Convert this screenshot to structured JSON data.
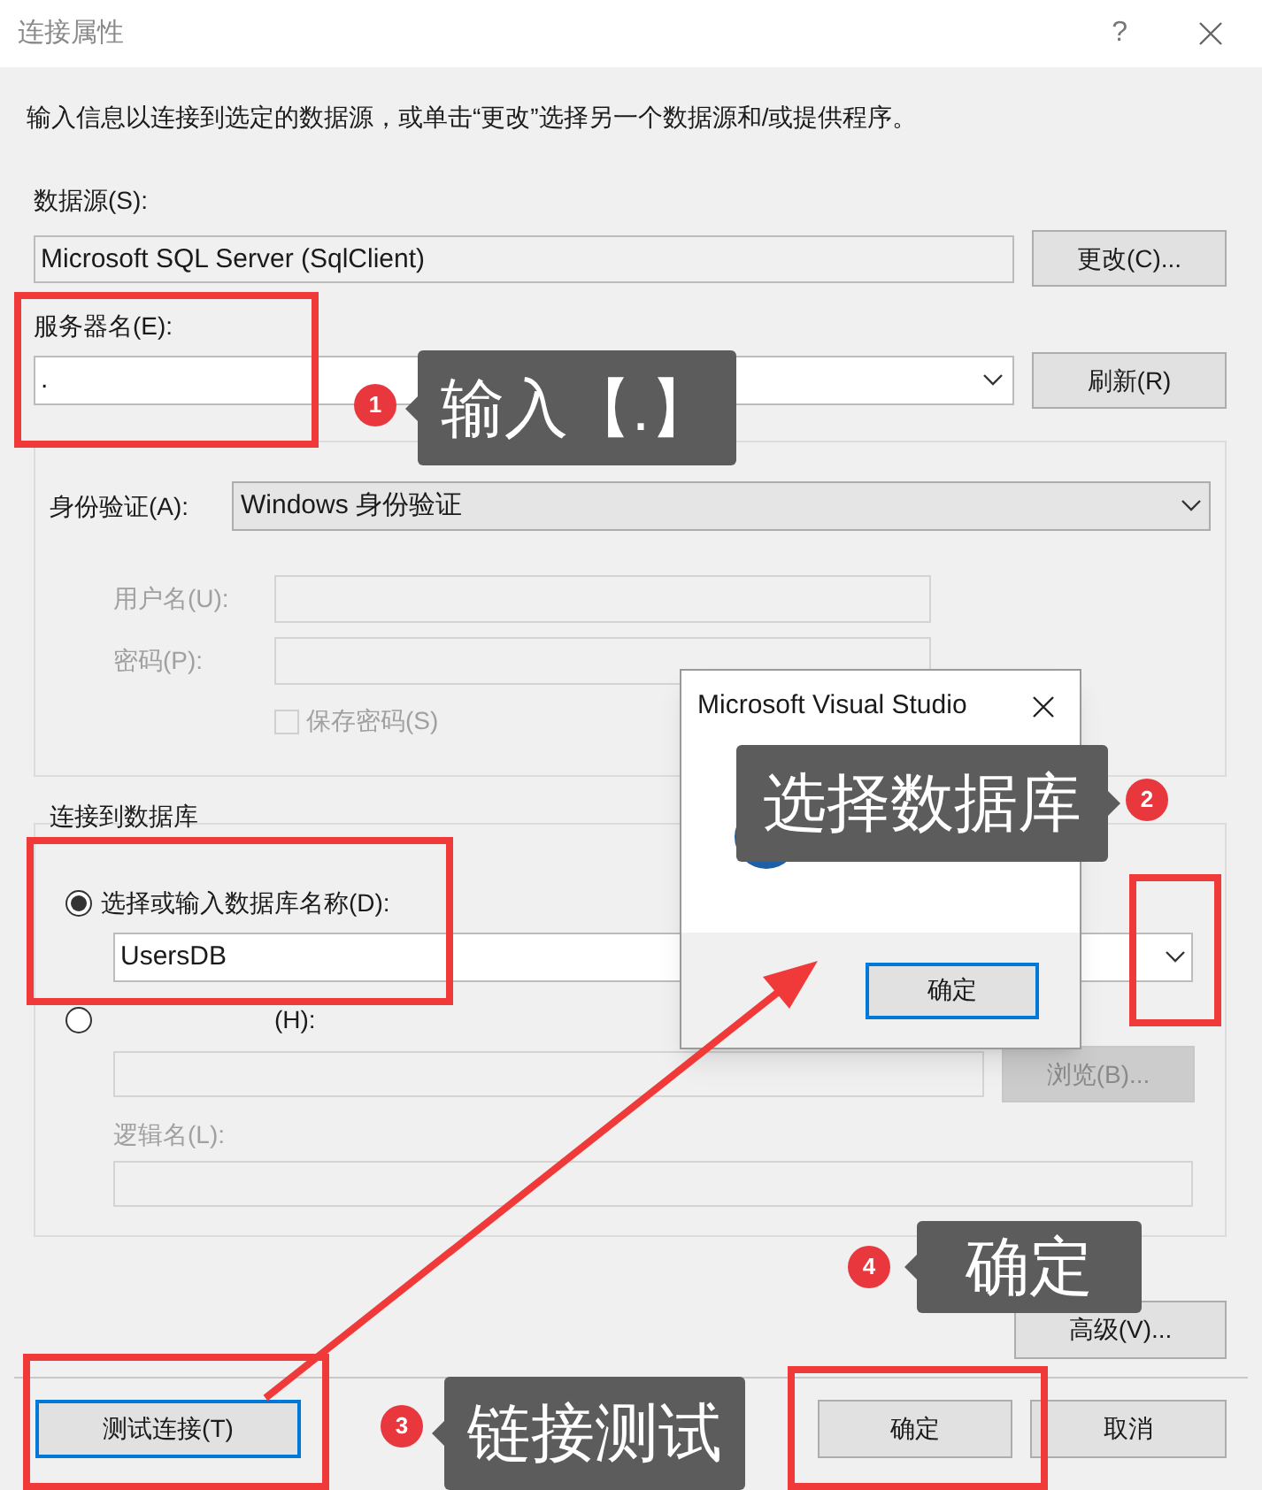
{
  "window": {
    "title": "连接属性",
    "help": "?"
  },
  "instructions": "输入信息以连接到选定的数据源，或单击“更改”选择另一个数据源和/或提供程序。",
  "data_source": {
    "label": "数据源(S):",
    "value": "Microsoft SQL Server (SqlClient)",
    "button": "更改(C)..."
  },
  "server_name": {
    "label": "服务器名(E):",
    "value": ".",
    "button": "刷新(R)"
  },
  "login_group": {
    "auth": {
      "label": "身份验证(A):",
      "value": "Windows 身份验证"
    },
    "username": {
      "label": "用户名(U):",
      "disabled": true
    },
    "password": {
      "label": "密码(P):",
      "disabled": true
    },
    "save_password": {
      "label": "保存密码(S)",
      "checked": false,
      "disabled": true
    }
  },
  "database_group": {
    "title": "连接到数据库",
    "options": [
      {
        "label": "选择或输入数据库名称(D):",
        "selected": true
      },
      {
        "label": "(H):",
        "selected": false
      }
    ],
    "database_name": "UsersDB",
    "browse_button": {
      "label": "浏览(B)...",
      "disabled": true
    },
    "logical_name": {
      "label": "逻辑名(L):",
      "disabled": true
    }
  },
  "advanced_button": "高级(V)...",
  "footer_buttons": [
    {
      "label": "测试连接(T)",
      "focused": true
    },
    {
      "label": "确定",
      "focused": false
    },
    {
      "label": "取消",
      "focused": false
    }
  ],
  "message_box": {
    "title": "Microsoft Visual Studio",
    "button": "确定"
  },
  "annotations": [
    {
      "number": "1",
      "text": "输入【.】"
    },
    {
      "number": "2",
      "text": "选择数据库"
    },
    {
      "number": "3",
      "text": "链接测试"
    },
    {
      "number": "4",
      "text": "确定"
    }
  ]
}
